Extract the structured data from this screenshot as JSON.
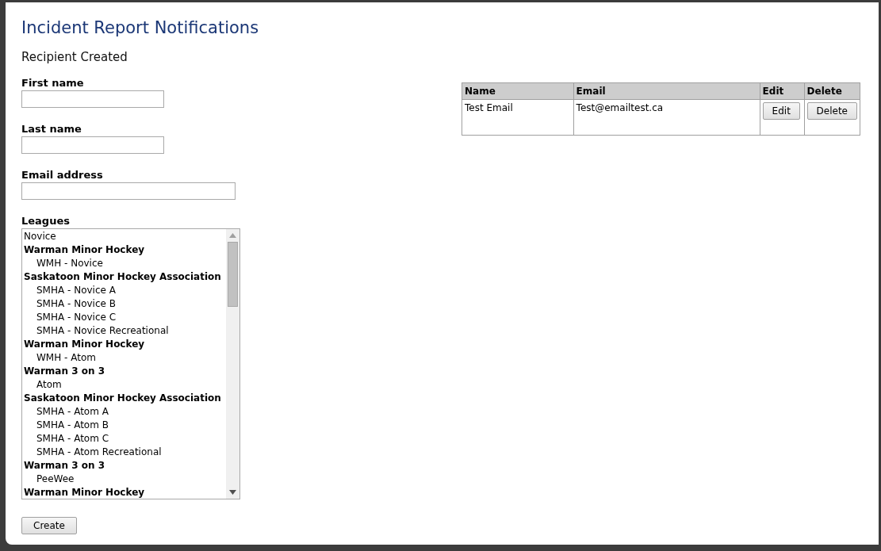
{
  "title": "Incident Report Notifications",
  "message": "Recipient Created",
  "fields": [
    {
      "label": "First name",
      "kind": "name"
    },
    {
      "label": "Last name",
      "kind": "name"
    },
    {
      "label": "Email address",
      "kind": "email"
    }
  ],
  "leagues": {
    "label": "Leagues",
    "items": [
      {
        "kind": "option",
        "label": "Novice"
      },
      {
        "kind": "group",
        "label": "Warman Minor Hockey",
        "children": [
          {
            "kind": "option",
            "label": "WMH - Novice"
          }
        ]
      },
      {
        "kind": "group",
        "label": "Saskatoon Minor Hockey Association",
        "children": [
          {
            "kind": "option",
            "label": "SMHA - Novice A"
          },
          {
            "kind": "option",
            "label": "SMHA - Novice B"
          },
          {
            "kind": "option",
            "label": "SMHA - Novice C"
          },
          {
            "kind": "option",
            "label": "SMHA - Novice Recreational"
          }
        ]
      },
      {
        "kind": "group",
        "label": "Warman Minor Hockey",
        "children": [
          {
            "kind": "option",
            "label": "WMH - Atom"
          }
        ]
      },
      {
        "kind": "group",
        "label": "Warman 3 on 3",
        "children": [
          {
            "kind": "option",
            "label": "Atom"
          }
        ]
      },
      {
        "kind": "group",
        "label": "Saskatoon Minor Hockey Association",
        "children": [
          {
            "kind": "option",
            "label": "SMHA - Atom A"
          },
          {
            "kind": "option",
            "label": "SMHA - Atom B"
          },
          {
            "kind": "option",
            "label": "SMHA - Atom C"
          },
          {
            "kind": "option",
            "label": "SMHA - Atom Recreational"
          }
        ]
      },
      {
        "kind": "group",
        "label": "Warman 3 on 3",
        "children": [
          {
            "kind": "option",
            "label": "PeeWee"
          }
        ]
      },
      {
        "kind": "group",
        "label": "Warman Minor Hockey"
      }
    ]
  },
  "create_button": "Create",
  "table": {
    "columns": [
      "Name",
      "Email",
      "Edit",
      "Delete"
    ],
    "rows": [
      {
        "name": "Test Email",
        "email": "Test@emailtest.ca",
        "edit": "Edit",
        "delete": "Delete"
      }
    ]
  }
}
